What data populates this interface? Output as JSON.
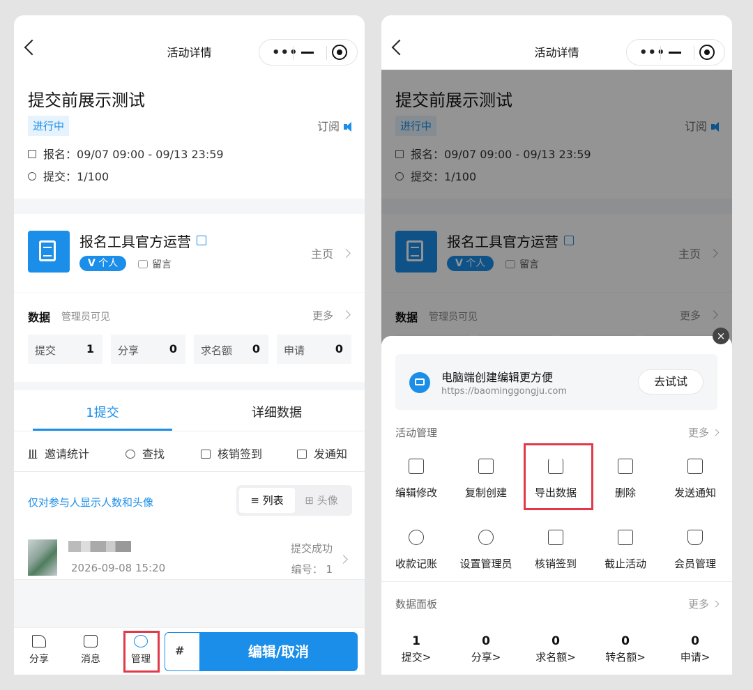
{
  "nav": {
    "title": "活动详情",
    "capsule_dots": "•••"
  },
  "activity": {
    "title": "提交前展示测试",
    "status": "进行中",
    "subscribe": "订阅",
    "signup_label": "报名：",
    "signup_range": "09/07 09:00 - 09/13 23:59",
    "submit_label": "提交：",
    "submit_count": "1/100"
  },
  "organizer": {
    "name": "报名工具官方运营",
    "badge": "个人",
    "badge_prefix": "V",
    "message": "留言",
    "home": "主页"
  },
  "data_section": {
    "title": "数据",
    "note": "管理员可见",
    "more": "更多",
    "stats": [
      {
        "label": "提交",
        "value": "1"
      },
      {
        "label": "分享",
        "value": "0"
      },
      {
        "label": "求名额",
        "value": "0"
      },
      {
        "label": "申请",
        "value": "0"
      }
    ]
  },
  "tabs": [
    {
      "label": "1提交"
    },
    {
      "label": "详细数据"
    }
  ],
  "tools": [
    {
      "label": "邀请统计",
      "icon": "bar-chart-icon"
    },
    {
      "label": "查找",
      "icon": "search-icon"
    },
    {
      "label": "核销签到",
      "icon": "checkbox-icon"
    },
    {
      "label": "发通知",
      "icon": "speaker-icon"
    }
  ],
  "participants_note": "仅对参与人显示人数和头像",
  "view_toggle": {
    "list": "≡ 列表",
    "avatar": "⊞ 头像"
  },
  "participant": {
    "date": "2026-09-08 15:20",
    "status": "提交成功",
    "number": "编号：  1"
  },
  "bottombar": {
    "share": "分享",
    "message": "消息",
    "manage": "管理",
    "coupon": "#",
    "main_button": "编辑/取消"
  },
  "sheet": {
    "close": "×",
    "promo_title": "电脑端创建编辑更方便",
    "promo_url": "https://baominggongju.com",
    "promo_button": "去试试",
    "manage_title": "活动管理",
    "manage_more": "更多",
    "actions_row1": [
      "编辑修改",
      "复制创建",
      "导出数据",
      "删除",
      "发送通知"
    ],
    "actions_row2": [
      "收款记账",
      "设置管理员",
      "核销签到",
      "截止活动",
      "会员管理"
    ],
    "dashboard_title": "数据面板",
    "dashboard_more": "更多",
    "dashboard": [
      {
        "value": "1",
        "label": "提交>"
      },
      {
        "value": "0",
        "label": "分享>"
      },
      {
        "value": "0",
        "label": "求名额>"
      },
      {
        "value": "0",
        "label": "转名额>"
      },
      {
        "value": "0",
        "label": "申请>"
      }
    ]
  },
  "colors": {
    "accent": "#1a8ee8",
    "highlight": "#e0394a"
  }
}
